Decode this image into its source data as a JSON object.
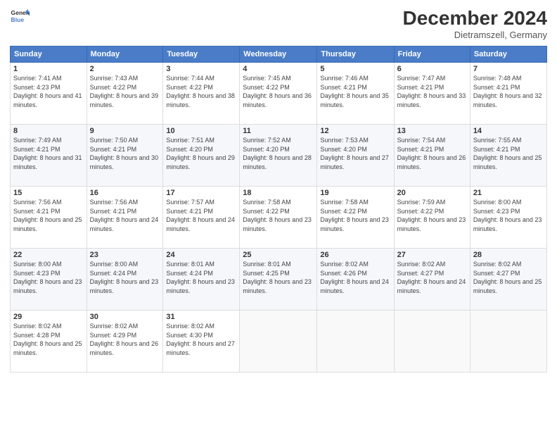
{
  "header": {
    "logo_line1": "General",
    "logo_line2": "Blue",
    "month_title": "December 2024",
    "subtitle": "Dietramszell, Germany"
  },
  "weekdays": [
    "Sunday",
    "Monday",
    "Tuesday",
    "Wednesday",
    "Thursday",
    "Friday",
    "Saturday"
  ],
  "weeks": [
    [
      {
        "day": "1",
        "sunrise": "Sunrise: 7:41 AM",
        "sunset": "Sunset: 4:23 PM",
        "daylight": "Daylight: 8 hours and 41 minutes."
      },
      {
        "day": "2",
        "sunrise": "Sunrise: 7:43 AM",
        "sunset": "Sunset: 4:22 PM",
        "daylight": "Daylight: 8 hours and 39 minutes."
      },
      {
        "day": "3",
        "sunrise": "Sunrise: 7:44 AM",
        "sunset": "Sunset: 4:22 PM",
        "daylight": "Daylight: 8 hours and 38 minutes."
      },
      {
        "day": "4",
        "sunrise": "Sunrise: 7:45 AM",
        "sunset": "Sunset: 4:22 PM",
        "daylight": "Daylight: 8 hours and 36 minutes."
      },
      {
        "day": "5",
        "sunrise": "Sunrise: 7:46 AM",
        "sunset": "Sunset: 4:21 PM",
        "daylight": "Daylight: 8 hours and 35 minutes."
      },
      {
        "day": "6",
        "sunrise": "Sunrise: 7:47 AM",
        "sunset": "Sunset: 4:21 PM",
        "daylight": "Daylight: 8 hours and 33 minutes."
      },
      {
        "day": "7",
        "sunrise": "Sunrise: 7:48 AM",
        "sunset": "Sunset: 4:21 PM",
        "daylight": "Daylight: 8 hours and 32 minutes."
      }
    ],
    [
      {
        "day": "8",
        "sunrise": "Sunrise: 7:49 AM",
        "sunset": "Sunset: 4:21 PM",
        "daylight": "Daylight: 8 hours and 31 minutes."
      },
      {
        "day": "9",
        "sunrise": "Sunrise: 7:50 AM",
        "sunset": "Sunset: 4:21 PM",
        "daylight": "Daylight: 8 hours and 30 minutes."
      },
      {
        "day": "10",
        "sunrise": "Sunrise: 7:51 AM",
        "sunset": "Sunset: 4:20 PM",
        "daylight": "Daylight: 8 hours and 29 minutes."
      },
      {
        "day": "11",
        "sunrise": "Sunrise: 7:52 AM",
        "sunset": "Sunset: 4:20 PM",
        "daylight": "Daylight: 8 hours and 28 minutes."
      },
      {
        "day": "12",
        "sunrise": "Sunrise: 7:53 AM",
        "sunset": "Sunset: 4:20 PM",
        "daylight": "Daylight: 8 hours and 27 minutes."
      },
      {
        "day": "13",
        "sunrise": "Sunrise: 7:54 AM",
        "sunset": "Sunset: 4:21 PM",
        "daylight": "Daylight: 8 hours and 26 minutes."
      },
      {
        "day": "14",
        "sunrise": "Sunrise: 7:55 AM",
        "sunset": "Sunset: 4:21 PM",
        "daylight": "Daylight: 8 hours and 25 minutes."
      }
    ],
    [
      {
        "day": "15",
        "sunrise": "Sunrise: 7:56 AM",
        "sunset": "Sunset: 4:21 PM",
        "daylight": "Daylight: 8 hours and 25 minutes."
      },
      {
        "day": "16",
        "sunrise": "Sunrise: 7:56 AM",
        "sunset": "Sunset: 4:21 PM",
        "daylight": "Daylight: 8 hours and 24 minutes."
      },
      {
        "day": "17",
        "sunrise": "Sunrise: 7:57 AM",
        "sunset": "Sunset: 4:21 PM",
        "daylight": "Daylight: 8 hours and 24 minutes."
      },
      {
        "day": "18",
        "sunrise": "Sunrise: 7:58 AM",
        "sunset": "Sunset: 4:22 PM",
        "daylight": "Daylight: 8 hours and 23 minutes."
      },
      {
        "day": "19",
        "sunrise": "Sunrise: 7:58 AM",
        "sunset": "Sunset: 4:22 PM",
        "daylight": "Daylight: 8 hours and 23 minutes."
      },
      {
        "day": "20",
        "sunrise": "Sunrise: 7:59 AM",
        "sunset": "Sunset: 4:22 PM",
        "daylight": "Daylight: 8 hours and 23 minutes."
      },
      {
        "day": "21",
        "sunrise": "Sunrise: 8:00 AM",
        "sunset": "Sunset: 4:23 PM",
        "daylight": "Daylight: 8 hours and 23 minutes."
      }
    ],
    [
      {
        "day": "22",
        "sunrise": "Sunrise: 8:00 AM",
        "sunset": "Sunset: 4:23 PM",
        "daylight": "Daylight: 8 hours and 23 minutes."
      },
      {
        "day": "23",
        "sunrise": "Sunrise: 8:00 AM",
        "sunset": "Sunset: 4:24 PM",
        "daylight": "Daylight: 8 hours and 23 minutes."
      },
      {
        "day": "24",
        "sunrise": "Sunrise: 8:01 AM",
        "sunset": "Sunset: 4:24 PM",
        "daylight": "Daylight: 8 hours and 23 minutes."
      },
      {
        "day": "25",
        "sunrise": "Sunrise: 8:01 AM",
        "sunset": "Sunset: 4:25 PM",
        "daylight": "Daylight: 8 hours and 23 minutes."
      },
      {
        "day": "26",
        "sunrise": "Sunrise: 8:02 AM",
        "sunset": "Sunset: 4:26 PM",
        "daylight": "Daylight: 8 hours and 24 minutes."
      },
      {
        "day": "27",
        "sunrise": "Sunrise: 8:02 AM",
        "sunset": "Sunset: 4:27 PM",
        "daylight": "Daylight: 8 hours and 24 minutes."
      },
      {
        "day": "28",
        "sunrise": "Sunrise: 8:02 AM",
        "sunset": "Sunset: 4:27 PM",
        "daylight": "Daylight: 8 hours and 25 minutes."
      }
    ],
    [
      {
        "day": "29",
        "sunrise": "Sunrise: 8:02 AM",
        "sunset": "Sunset: 4:28 PM",
        "daylight": "Daylight: 8 hours and 25 minutes."
      },
      {
        "day": "30",
        "sunrise": "Sunrise: 8:02 AM",
        "sunset": "Sunset: 4:29 PM",
        "daylight": "Daylight: 8 hours and 26 minutes."
      },
      {
        "day": "31",
        "sunrise": "Sunrise: 8:02 AM",
        "sunset": "Sunset: 4:30 PM",
        "daylight": "Daylight: 8 hours and 27 minutes."
      },
      null,
      null,
      null,
      null
    ]
  ]
}
